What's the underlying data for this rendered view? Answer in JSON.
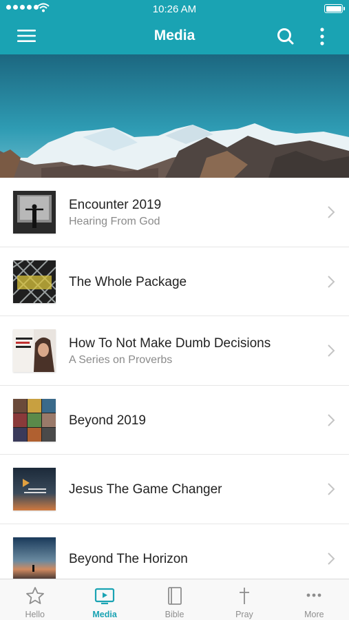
{
  "status_bar": {
    "time": "10:26 AM"
  },
  "nav": {
    "title": "Media",
    "menu_icon": "hamburger-menu-icon",
    "search_icon": "search-icon",
    "more_icon": "more-vertical-icon"
  },
  "colors": {
    "brand": "#1aa3b3",
    "inactive": "#8e8e8e"
  },
  "media_items": [
    {
      "title": "Encounter 2019",
      "subtitle": "Hearing From God"
    },
    {
      "title": "The Whole Package",
      "subtitle": ""
    },
    {
      "title": "How To Not Make Dumb Decisions",
      "subtitle": "A Series on Proverbs"
    },
    {
      "title": "Beyond 2019",
      "subtitle": ""
    },
    {
      "title": "Jesus The Game Changer",
      "subtitle": ""
    },
    {
      "title": "Beyond The Horizon",
      "subtitle": ""
    }
  ],
  "tabs": [
    {
      "label": "Hello",
      "icon": "star-icon",
      "active": false
    },
    {
      "label": "Media",
      "icon": "tv-play-icon",
      "active": true
    },
    {
      "label": "Bible",
      "icon": "book-icon",
      "active": false
    },
    {
      "label": "Pray",
      "icon": "cross-icon",
      "active": false
    },
    {
      "label": "More",
      "icon": "ellipsis-icon",
      "active": false
    }
  ]
}
